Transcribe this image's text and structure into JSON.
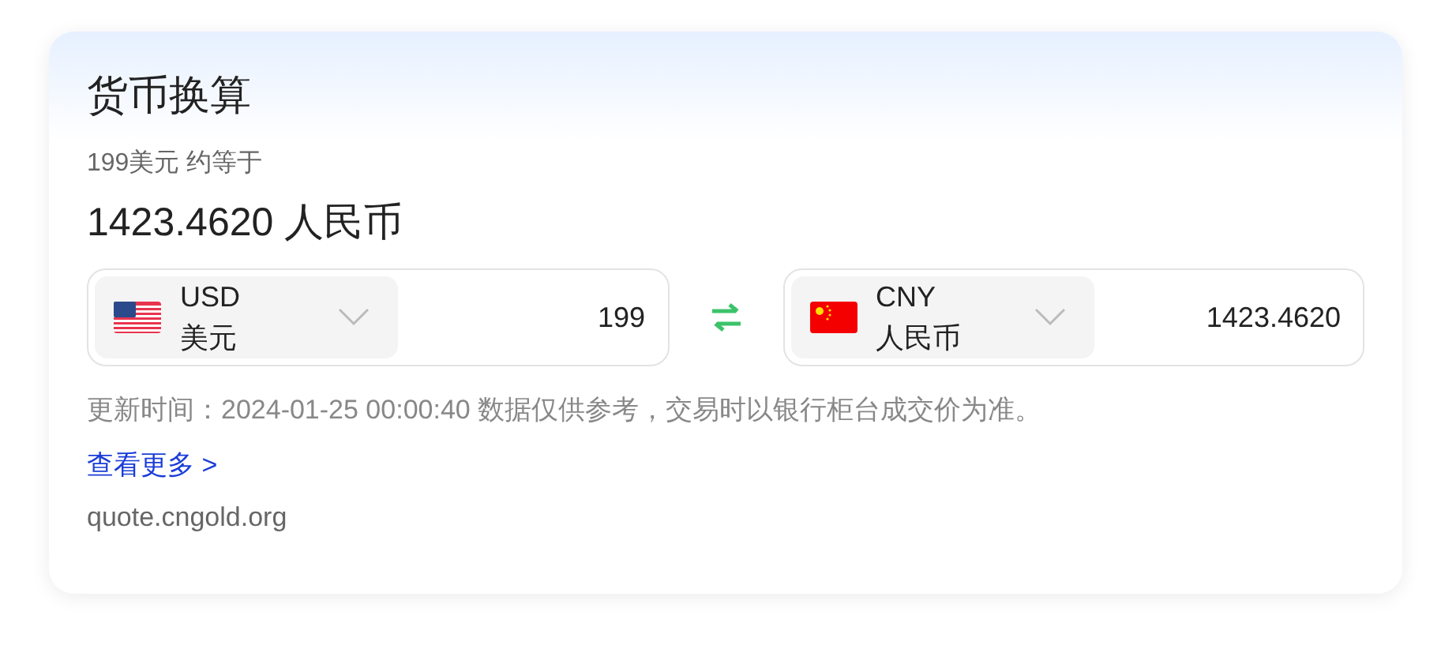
{
  "title": "货币换算",
  "summary": "199美元 约等于",
  "result": "1423.4620 人民币",
  "converters": [
    {
      "code": "USD",
      "name": "美元",
      "value": "199"
    },
    {
      "code": "CNY",
      "name": "人民币",
      "value": "1423.4620"
    }
  ],
  "note": "更新时间：2024-01-25 00:00:40 数据仅供参考，交易时以银行柜台成交价为准。",
  "more_link": "查看更多 >",
  "source": "quote.cngold.org"
}
